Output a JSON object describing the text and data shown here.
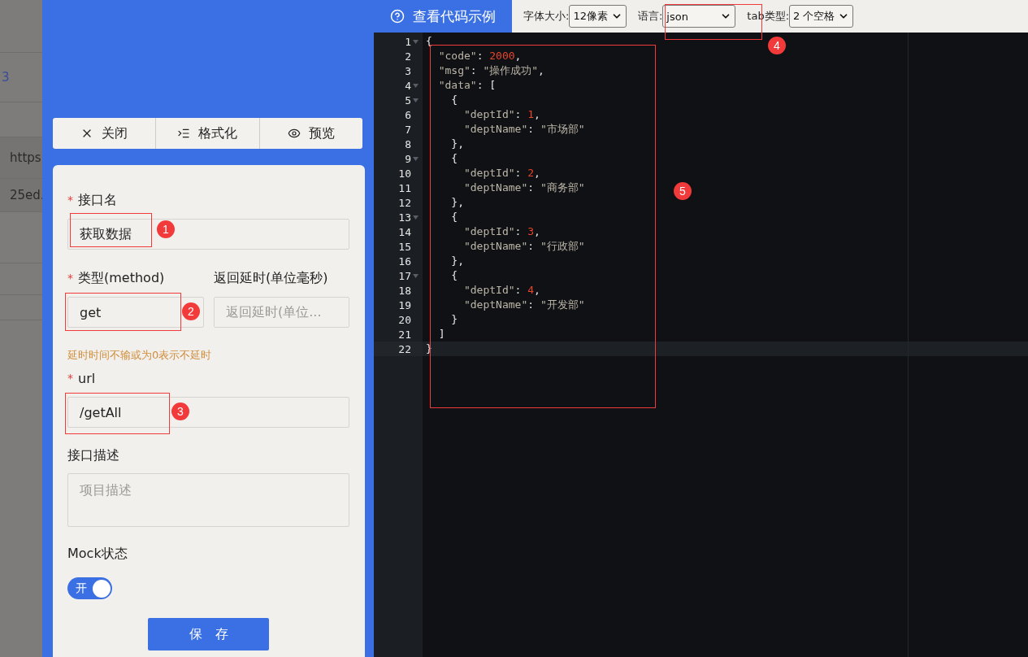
{
  "background_table": {
    "rows": [
      {
        "text": "3",
        "kind": "link"
      },
      {
        "text": "https",
        "kind": "plain"
      },
      {
        "text": "25ed.",
        "kind": "plain"
      }
    ]
  },
  "action_bar": [
    {
      "label": "关闭",
      "kind": "close"
    },
    {
      "label": "格式化",
      "kind": "format"
    },
    {
      "label": "预览",
      "kind": "preview"
    }
  ],
  "form": {
    "name": {
      "label": "接口名",
      "required_mark": "*",
      "value": "获取数据"
    },
    "method": {
      "label": "类型(method)",
      "required_mark": "*",
      "value": "get"
    },
    "delay": {
      "label": "返回延时(单位毫秒)",
      "placeholder": "返回延时(单位..."
    },
    "hint": "延时时间不输或为0表示不延时",
    "url": {
      "label": "url",
      "required_mark": "*",
      "value": "/getAll"
    },
    "description": {
      "label": "接口描述",
      "placeholder": "项目描述"
    },
    "mock": {
      "label": "Mock状态",
      "on": true,
      "switch_text": "开"
    },
    "save": "保　存"
  },
  "editor_toolbar": {
    "example_link": "查看代码示例",
    "settings": [
      {
        "label": "字体大小:",
        "value": "12像素"
      },
      {
        "label": "语言:",
        "value": "json"
      },
      {
        "label": "tab类型:",
        "value": "2 个空格"
      }
    ]
  },
  "code_lines": [
    {
      "number": "1",
      "foldable": true,
      "current": false,
      "tokens": [
        {
          "kind": "punct",
          "text": "{"
        }
      ]
    },
    {
      "number": "2",
      "foldable": false,
      "current": false,
      "tokens": [
        {
          "kind": "key",
          "text": "  \"code\""
        },
        {
          "kind": "punct",
          "text": ": "
        },
        {
          "kind": "num",
          "text": "2000"
        },
        {
          "kind": "punct",
          "text": ","
        }
      ]
    },
    {
      "number": "3",
      "foldable": false,
      "current": false,
      "tokens": [
        {
          "kind": "key",
          "text": "  \"msg\""
        },
        {
          "kind": "punct",
          "text": ": "
        },
        {
          "kind": "str",
          "text": "\"操作成功\""
        },
        {
          "kind": "punct",
          "text": ","
        }
      ]
    },
    {
      "number": "4",
      "foldable": true,
      "current": false,
      "tokens": [
        {
          "kind": "key",
          "text": "  \"data\""
        },
        {
          "kind": "punct",
          "text": ": ["
        }
      ]
    },
    {
      "number": "5",
      "foldable": true,
      "current": false,
      "tokens": [
        {
          "kind": "punct",
          "text": "    {"
        }
      ]
    },
    {
      "number": "6",
      "foldable": false,
      "current": false,
      "tokens": [
        {
          "kind": "key",
          "text": "      \"deptId\""
        },
        {
          "kind": "punct",
          "text": ": "
        },
        {
          "kind": "num",
          "text": "1"
        },
        {
          "kind": "punct",
          "text": ","
        }
      ]
    },
    {
      "number": "7",
      "foldable": false,
      "current": false,
      "tokens": [
        {
          "kind": "key",
          "text": "      \"deptName\""
        },
        {
          "kind": "punct",
          "text": ": "
        },
        {
          "kind": "str",
          "text": "\"市场部\""
        }
      ]
    },
    {
      "number": "8",
      "foldable": false,
      "current": false,
      "tokens": [
        {
          "kind": "punct",
          "text": "    },"
        }
      ]
    },
    {
      "number": "9",
      "foldable": true,
      "current": false,
      "tokens": [
        {
          "kind": "punct",
          "text": "    {"
        }
      ]
    },
    {
      "number": "10",
      "foldable": false,
      "current": false,
      "tokens": [
        {
          "kind": "key",
          "text": "      \"deptId\""
        },
        {
          "kind": "punct",
          "text": ": "
        },
        {
          "kind": "num",
          "text": "2"
        },
        {
          "kind": "punct",
          "text": ","
        }
      ]
    },
    {
      "number": "11",
      "foldable": false,
      "current": false,
      "tokens": [
        {
          "kind": "key",
          "text": "      \"deptName\""
        },
        {
          "kind": "punct",
          "text": ": "
        },
        {
          "kind": "str",
          "text": "\"商务部\""
        }
      ]
    },
    {
      "number": "12",
      "foldable": false,
      "current": false,
      "tokens": [
        {
          "kind": "punct",
          "text": "    },"
        }
      ]
    },
    {
      "number": "13",
      "foldable": true,
      "current": false,
      "tokens": [
        {
          "kind": "punct",
          "text": "    {"
        }
      ]
    },
    {
      "number": "14",
      "foldable": false,
      "current": false,
      "tokens": [
        {
          "kind": "key",
          "text": "      \"deptId\""
        },
        {
          "kind": "punct",
          "text": ": "
        },
        {
          "kind": "num",
          "text": "3"
        },
        {
          "kind": "punct",
          "text": ","
        }
      ]
    },
    {
      "number": "15",
      "foldable": false,
      "current": false,
      "tokens": [
        {
          "kind": "key",
          "text": "      \"deptName\""
        },
        {
          "kind": "punct",
          "text": ": "
        },
        {
          "kind": "str",
          "text": "\"行政部\""
        }
      ]
    },
    {
      "number": "16",
      "foldable": false,
      "current": false,
      "tokens": [
        {
          "kind": "punct",
          "text": "    },"
        }
      ]
    },
    {
      "number": "17",
      "foldable": true,
      "current": false,
      "tokens": [
        {
          "kind": "punct",
          "text": "    {"
        }
      ]
    },
    {
      "number": "18",
      "foldable": false,
      "current": false,
      "tokens": [
        {
          "kind": "key",
          "text": "      \"deptId\""
        },
        {
          "kind": "punct",
          "text": ": "
        },
        {
          "kind": "num",
          "text": "4"
        },
        {
          "kind": "punct",
          "text": ","
        }
      ]
    },
    {
      "number": "19",
      "foldable": false,
      "current": false,
      "tokens": [
        {
          "kind": "key",
          "text": "      \"deptName\""
        },
        {
          "kind": "punct",
          "text": ": "
        },
        {
          "kind": "str",
          "text": "\"开发部\""
        }
      ]
    },
    {
      "number": "20",
      "foldable": false,
      "current": false,
      "tokens": [
        {
          "kind": "punct",
          "text": "    }"
        }
      ]
    },
    {
      "number": "21",
      "foldable": false,
      "current": false,
      "tokens": [
        {
          "kind": "punct",
          "text": "  ]"
        }
      ]
    },
    {
      "number": "22",
      "foldable": false,
      "current": true,
      "tokens": [
        {
          "kind": "punct",
          "text": "}"
        }
      ]
    }
  ],
  "annotations": [
    {
      "label": "1"
    },
    {
      "label": "2"
    },
    {
      "label": "3"
    },
    {
      "label": "4"
    },
    {
      "label": "5"
    }
  ]
}
